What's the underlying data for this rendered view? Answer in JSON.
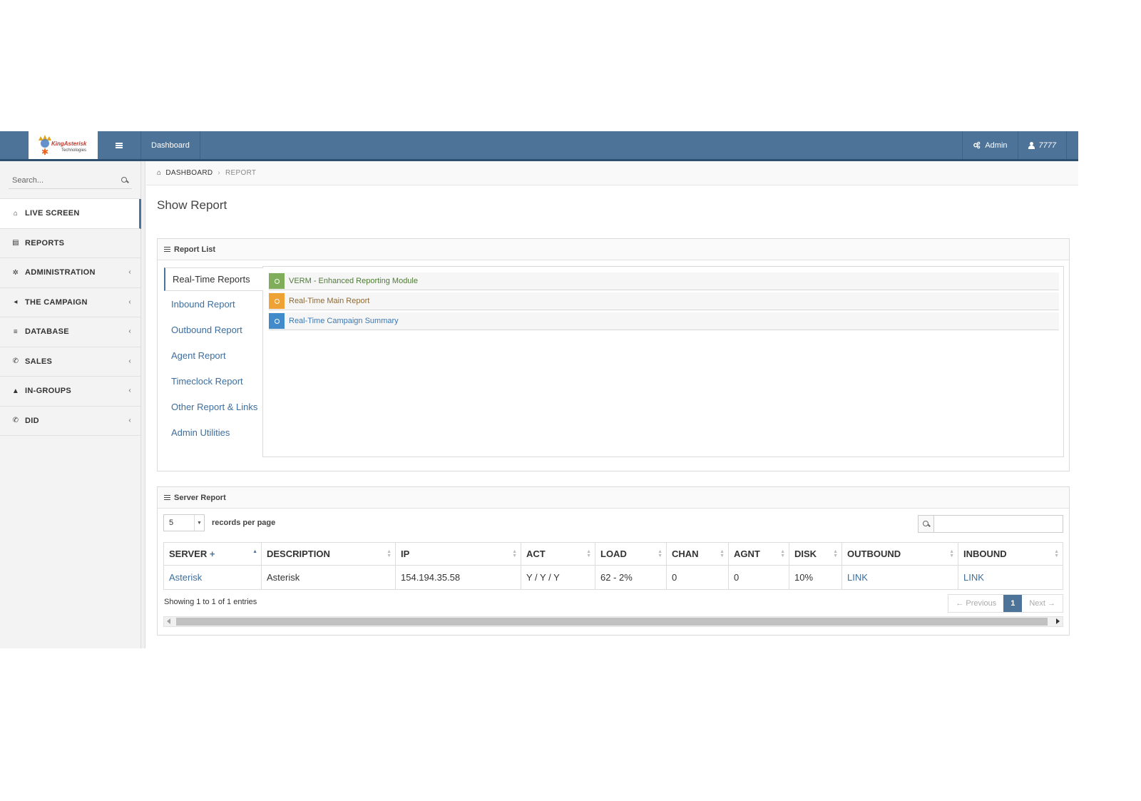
{
  "header": {
    "logo_text": "KingAsterisk",
    "logo_sub": "Technologies",
    "nav_dashboard": "Dashboard",
    "admin_label": "Admin",
    "user_label": "7777",
    "accent_color": "#4d7398"
  },
  "sidebar": {
    "search_placeholder": "Search...",
    "items": [
      {
        "label": "LIVE SCREEN",
        "icon": "home-icon",
        "glyph": "⌂"
      },
      {
        "label": "REPORTS",
        "icon": "chart-icon",
        "glyph": "▤"
      },
      {
        "label": "ADMINISTRATION",
        "icon": "gear-icon",
        "glyph": "✲"
      },
      {
        "label": "THE CAMPAIGN",
        "icon": "bullhorn-icon",
        "glyph": "◂"
      },
      {
        "label": "DATABASE",
        "icon": "database-icon",
        "glyph": "≡"
      },
      {
        "label": "SALES",
        "icon": "phone-icon",
        "glyph": "✆"
      },
      {
        "label": "IN-GROUPS",
        "icon": "user-icon",
        "glyph": "▲"
      },
      {
        "label": "DID",
        "icon": "phone-icon",
        "glyph": "✆"
      }
    ],
    "chevron": "‹"
  },
  "breadcrumb": {
    "home": "DASHBOARD",
    "separator": "›",
    "current": "REPORT"
  },
  "page_title": "Show Report",
  "report_list": {
    "title": "Report List",
    "tabs": [
      "Real-Time Reports",
      "Inbound Report",
      "Outbound Report",
      "Agent Report",
      "Timeclock Report",
      "Other Report & Links",
      "Admin Utilities"
    ],
    "active_tab": "Real-Time Reports",
    "reports": [
      {
        "label": "VERM - Enhanced Reporting Module",
        "color": "#7fad5a",
        "text_color": "#4f7a36"
      },
      {
        "label": "Real-Time Main Report",
        "color": "#eea236",
        "text_color": "#8a6a3a"
      },
      {
        "label": "Real-Time Campaign Summary",
        "color": "#428bca",
        "text_color": "#3c78b4"
      }
    ]
  },
  "server_report": {
    "title": "Server Report",
    "page_size": "5",
    "records_label": "records per page",
    "search_value": "",
    "columns": [
      "SERVER",
      "DESCRIPTION",
      "IP",
      "ACT",
      "LOAD",
      "CHAN",
      "AGNT",
      "DISK",
      "OUTBOUND",
      "INBOUND"
    ],
    "server_col_plus": "+",
    "rows": [
      {
        "server": "Asterisk",
        "description": "Asterisk",
        "ip": "154.194.35.58",
        "act": "Y / Y / Y",
        "load": "62 - 2%",
        "chan": "0",
        "agnt": "0",
        "disk": "10%",
        "outbound": "LINK",
        "inbound": "LINK"
      }
    ],
    "showing": "Showing 1 to 1 of 1 entries",
    "pager": {
      "previous": "← Previous",
      "page": "1",
      "next": "Next →"
    }
  }
}
